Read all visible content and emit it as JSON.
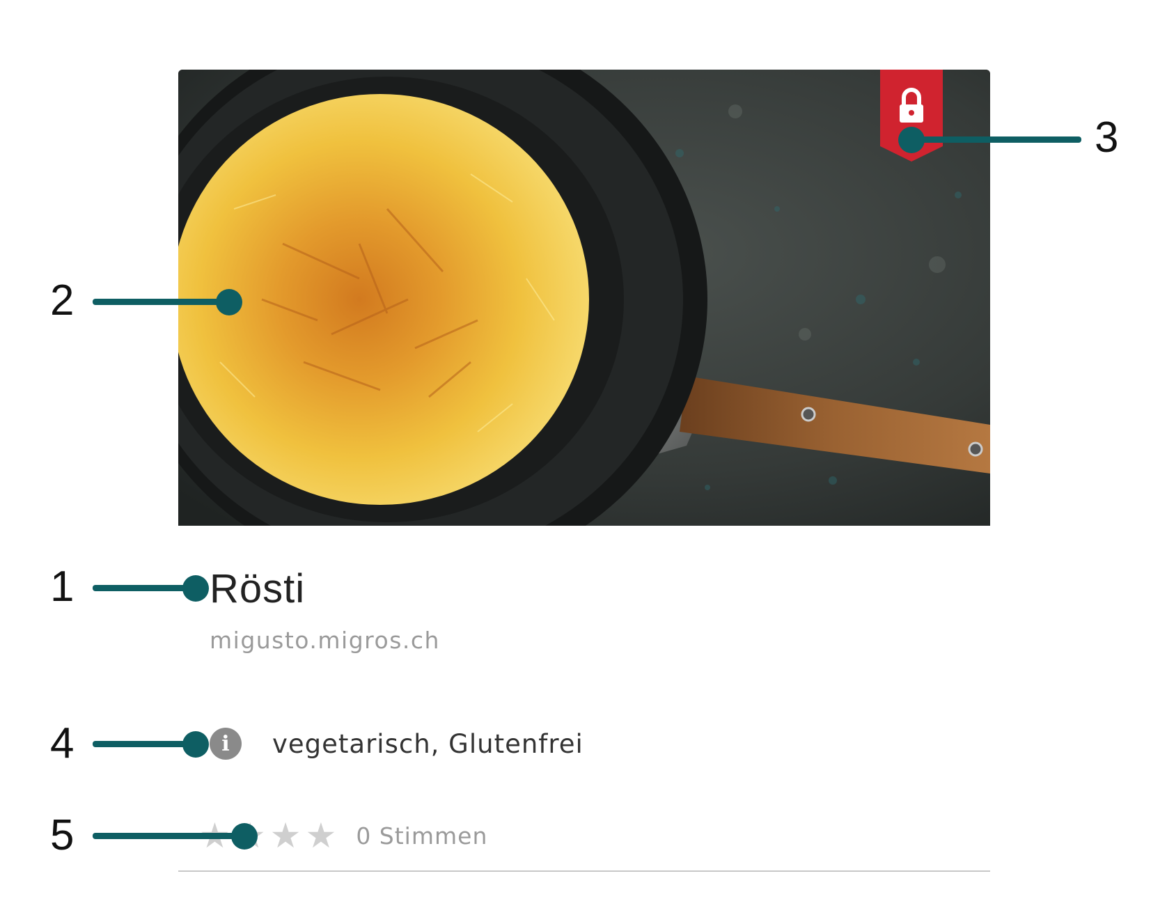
{
  "recipe": {
    "title": "Rösti",
    "source": "migusto.migros.ch",
    "tags": "vegetarisch, Glutenfrei",
    "rating": {
      "value": 0,
      "max": 4,
      "votes_label": "0 Stimmen"
    },
    "premium_locked": true
  },
  "icons": {
    "lock": "lock-icon",
    "info": "info-icon",
    "info_glyph": "i",
    "star": "star-icon",
    "star_glyph": "★"
  },
  "callouts": [
    {
      "number": "1",
      "target": "recipe-title"
    },
    {
      "number": "2",
      "target": "recipe-photo"
    },
    {
      "number": "3",
      "target": "lock-ribbon"
    },
    {
      "number": "4",
      "target": "diet-info"
    },
    {
      "number": "5",
      "target": "rating-stars"
    }
  ],
  "colors": {
    "ribbon": "#d0232f",
    "callout": "#0e5e63",
    "star_empty": "#cfcfcf",
    "muted_text": "#9a9a9a"
  }
}
